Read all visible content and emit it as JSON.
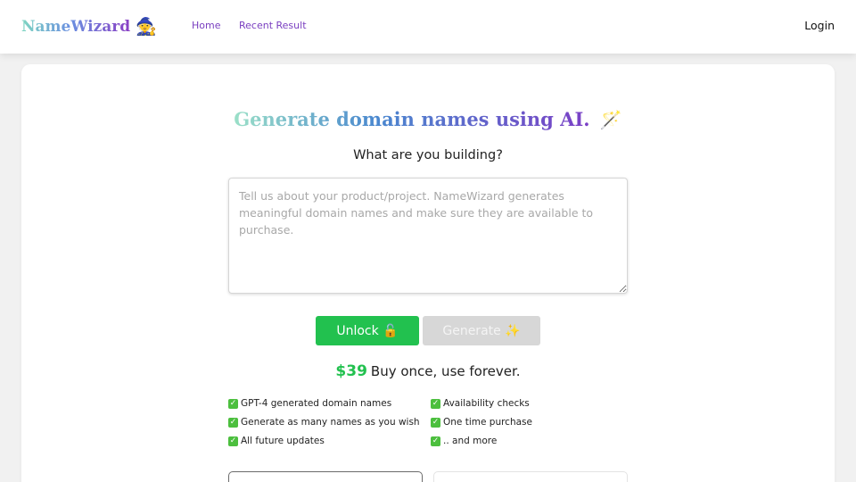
{
  "nav": {
    "logo_text": "NameWizard",
    "logo_emoji": "🧙",
    "links": [
      {
        "label": "Home"
      },
      {
        "label": "Recent Result"
      }
    ],
    "login_label": "Login"
  },
  "hero": {
    "title": "Generate domain names using AI.",
    "emoji": "🪄",
    "subtitle": "What are you building?"
  },
  "input": {
    "placeholder": "Tell us about your product/project. NameWizard generates meaningful domain names and make sure they are available to purchase.",
    "value": ""
  },
  "buttons": {
    "unlock_label": "Unlock 🔓",
    "generate_label": "Generate ✨"
  },
  "pricing": {
    "price": "$39",
    "tagline": "Buy once, use forever."
  },
  "features": [
    "GPT-4 generated domain names",
    "Availability checks",
    "Generate as many names as you wish",
    "One time purchase",
    "All future updates",
    ".. and more"
  ],
  "colors": {
    "accent_green": "#22c14f",
    "nav_link_purple": "#7a3fc0",
    "disabled_gray": "#d7d7d7"
  },
  "icons": {
    "feature_check": "check-box-icon"
  }
}
